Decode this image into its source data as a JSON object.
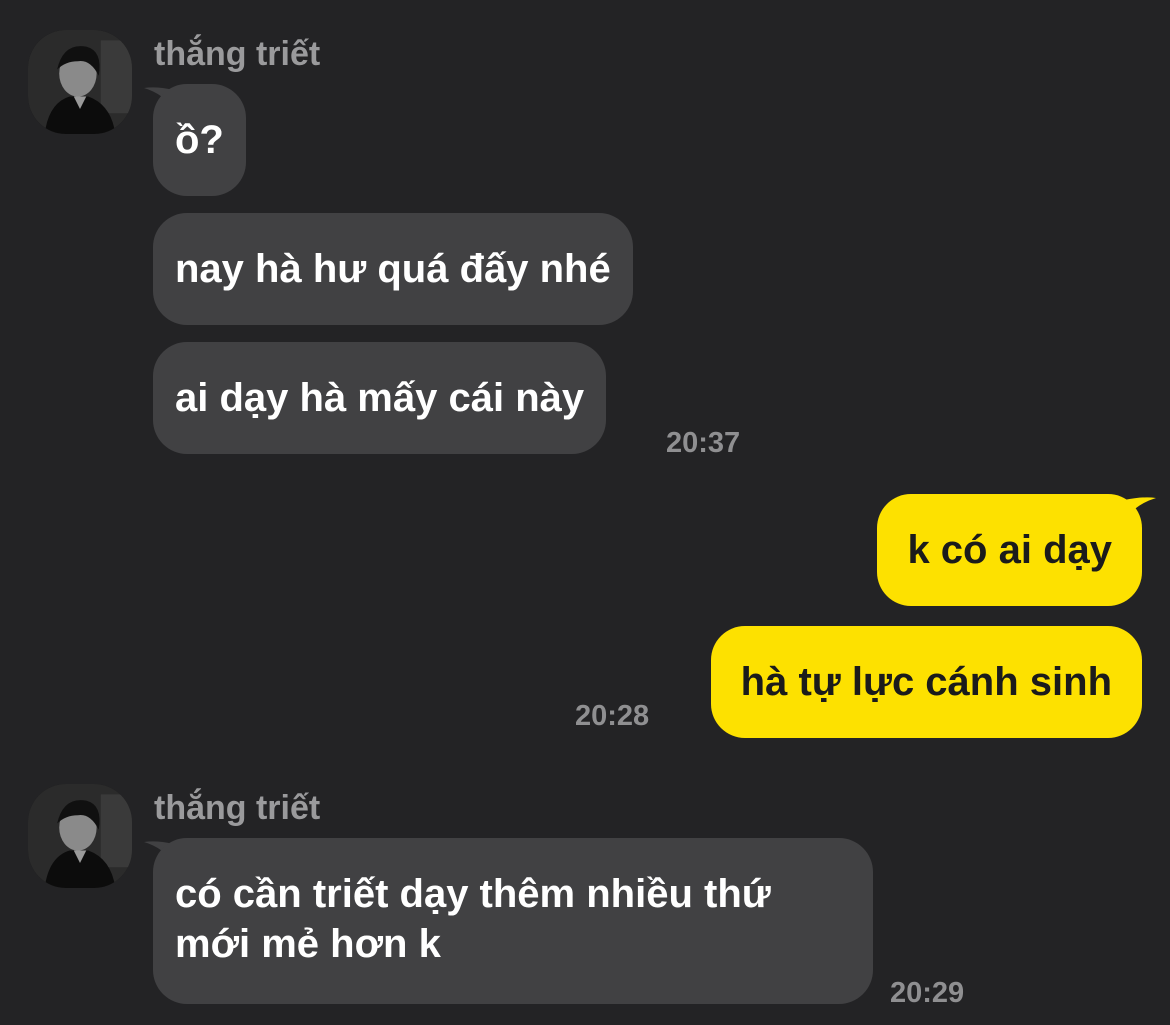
{
  "groups": [
    {
      "sender": "thắng triết",
      "avatar_icon": "profile-photo",
      "messages": [
        "ồ?",
        "nay hà hư quá đấy nhé",
        "ai dạy hà mấy cái này"
      ],
      "time": "20:37"
    },
    {
      "messages": [
        "k có ai dạy",
        "hà tự lực cánh sinh"
      ],
      "time": "20:28"
    },
    {
      "sender": "thắng triết",
      "avatar_icon": "profile-photo",
      "messages": [
        "có cần triết dạy thêm nhiều thứ mới mẻ hơn k"
      ],
      "time": "20:29"
    }
  ],
  "colors": {
    "background": "#232325",
    "incoming_bubble": "#414143",
    "outgoing_bubble": "#fde100",
    "meta_text": "#9a9a9c"
  }
}
